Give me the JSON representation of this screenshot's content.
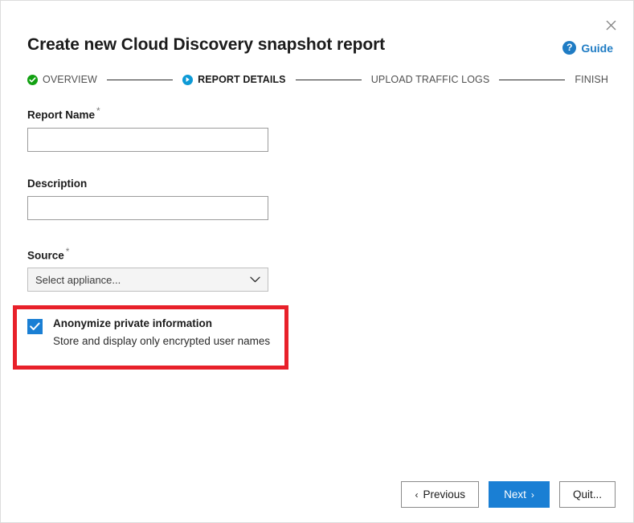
{
  "dialog": {
    "title": "Create new Cloud Discovery snapshot report",
    "close_icon": "close-icon"
  },
  "guide": {
    "label": "Guide",
    "icon": "question-mark-icon",
    "color": "#1f7cc4"
  },
  "stepper": {
    "steps": [
      {
        "label": "OVERVIEW",
        "state": "done",
        "marker_icon": "check-circle-icon"
      },
      {
        "label": "REPORT DETAILS",
        "state": "current",
        "marker_icon": "play-circle-icon"
      },
      {
        "label": "UPLOAD TRAFFIC LOGS",
        "state": "pending",
        "marker_icon": ""
      },
      {
        "label": "FINISH",
        "state": "pending",
        "marker_icon": ""
      }
    ],
    "done_color": "#12a112",
    "current_color": "#0d9ad6"
  },
  "form": {
    "report_name": {
      "label": "Report Name",
      "required_mark": "*",
      "value": "",
      "placeholder": ""
    },
    "description": {
      "label": "Description",
      "value": "",
      "placeholder": ""
    },
    "source": {
      "label": "Source",
      "required_mark": "*",
      "selected": "Select appliance...",
      "chevron_icon": "chevron-down-icon"
    }
  },
  "anonymize": {
    "checked": true,
    "label": "Anonymize private information",
    "sublabel": "Store and display only encrypted user names",
    "checkbox_color": "#1a7fd4",
    "highlight_color": "#e8202a"
  },
  "footer": {
    "previous_label": "Previous",
    "previous_chevron": "‹",
    "next_label": "Next",
    "next_chevron": "›",
    "quit_label": "Quit...",
    "primary_color": "#1a7fd4"
  }
}
